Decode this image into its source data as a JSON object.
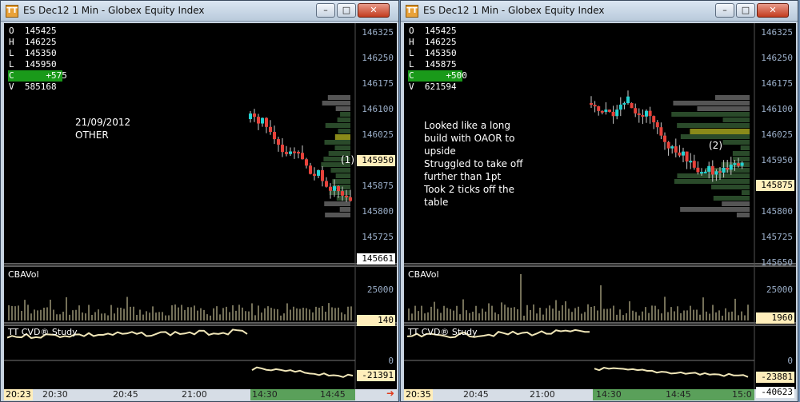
{
  "windows": [
    {
      "title": "ES Dec12 1 Min - Globex Equity Index",
      "ohlc": [
        {
          "k": "O",
          "v": "145425"
        },
        {
          "k": "H",
          "v": "146225"
        },
        {
          "k": "L",
          "v": "145350"
        },
        {
          "k": "L",
          "v": "145950"
        },
        {
          "k": "C",
          "v": "+575"
        },
        {
          "k": "V",
          "v": "585168"
        }
      ],
      "note": "21/09/2012\nOTHER",
      "marker": "(1)",
      "price_ticks": [
        "146325",
        "146250",
        "146175",
        "146100",
        "146025",
        "145950",
        "145875",
        "145800",
        "145725",
        "145661"
      ],
      "price_current": "145950",
      "price_low_box": "145661",
      "cbavol_label": "CBAVol",
      "cbavol_tick": "25000",
      "cbavol_current": "140",
      "cvd_label": "TT CVD® Study",
      "cvd_zero": "0",
      "cvd_current": "-21391",
      "time_box": "20:23",
      "time_ticks": [
        "20:30",
        "20:45",
        "21:00",
        "14:30",
        "14:45"
      ]
    },
    {
      "title": "ES Dec12 1 Min - Globex Equity Index",
      "ohlc": [
        {
          "k": "O",
          "v": "145425"
        },
        {
          "k": "H",
          "v": "146225"
        },
        {
          "k": "L",
          "v": "145350"
        },
        {
          "k": "L",
          "v": "145875"
        },
        {
          "k": "C",
          "v": "+500"
        },
        {
          "k": "V",
          "v": "621594"
        }
      ],
      "note": "Looked like a long\nbuild with OAOR to\nupside\nStruggled to take off\nfurther than 1pt\nTook 2 ticks off the\ntable",
      "marker": "(2)",
      "price_ticks": [
        "146325",
        "146250",
        "146175",
        "146100",
        "146025",
        "145950",
        "145875",
        "145800",
        "145725",
        "145650"
      ],
      "price_current": "145875",
      "cbavol_label": "CBAVol",
      "cbavol_tick": "25000",
      "cbavol_current": "1960",
      "cvd_label": "TT CVD® Study",
      "cvd_zero": "0",
      "cvd_current": "-23881",
      "cvd_low": "-40623",
      "time_box": "20:35",
      "time_ticks": [
        "20:45",
        "21:00",
        "14:30",
        "14:45",
        "15:0"
      ]
    }
  ],
  "colors": {
    "up": "#22d3d3",
    "down": "#e8423a",
    "volume_profile": "#2a4a2a",
    "poc": "#8a8a1a"
  }
}
